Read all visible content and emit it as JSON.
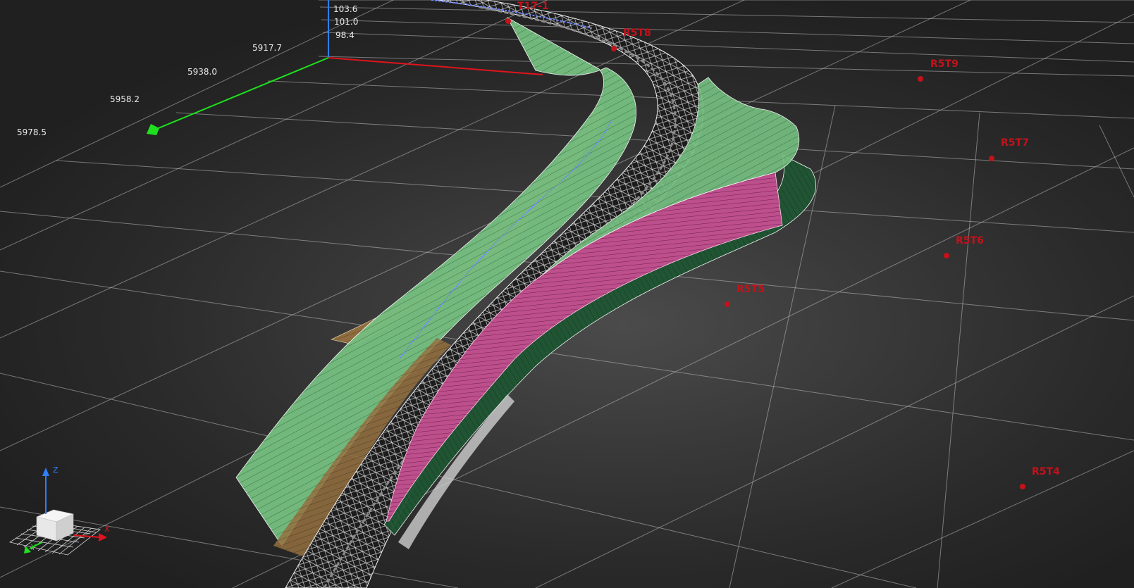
{
  "viewport": {
    "background": "#2b2b2b",
    "grid_color": "#bdbdbd",
    "axis_colors": {
      "x": "#e0141c",
      "y": "#1fe01f",
      "z": "#2f7fff"
    }
  },
  "z_axis_labels": [
    "103.6",
    "101.0",
    "98.4"
  ],
  "y_axis_labels": [
    "5917.7",
    "5938.0",
    "5958.2",
    "5978.5"
  ],
  "stations": [
    {
      "id": "t17-1",
      "label": "T17-1"
    },
    {
      "id": "r5t8",
      "label": "R5T8"
    },
    {
      "id": "r5t9",
      "label": "R5T9"
    },
    {
      "id": "r5t7",
      "label": "R5T7"
    },
    {
      "id": "r5t6",
      "label": "R5T6"
    },
    {
      "id": "r5t5",
      "label": "R5T5"
    },
    {
      "id": "r5t4",
      "label": "R5T4"
    }
  ],
  "gizmo": {
    "x_label": "X",
    "y_label": "Y",
    "z_label": "Z"
  },
  "surfaces": {
    "embankment_color": "#7fc98a",
    "road_color": "#1b1b1b",
    "wall_color": "#c0508f",
    "berm_color": "#9b7347",
    "outer_slope_color": "#1f5a34",
    "mesh_line_color": "#e6e6e6"
  },
  "marker_color": "#c4121b"
}
